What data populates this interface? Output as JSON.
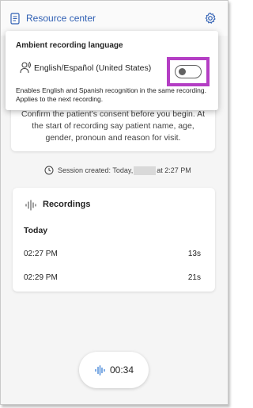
{
  "header": {
    "title": "Resource center",
    "doc_icon": "document-icon",
    "settings_icon": "gear-icon"
  },
  "popup": {
    "heading": "Ambient recording language",
    "language_icon": "person-voice-icon",
    "language_label": "English/Español (United States)",
    "toggle_state": "off",
    "description": "Enables English and Spanish recognition in the same recording. Applies to the next recording."
  },
  "consent": {
    "text": "Confirm the patient’s consent before you begin. At the start of recording say patient name, age, gender, pronoun and reason for visit."
  },
  "session": {
    "clock_icon": "clock-icon",
    "prefix": "Session created: Today,",
    "suffix": "at 2:27 PM"
  },
  "recordings": {
    "heading": "Recordings",
    "wave_icon": "sound-wave-icon",
    "group_label": "Today",
    "items": [
      {
        "time": "02:27 PM",
        "duration": "13s"
      },
      {
        "time": "02:29 PM",
        "duration": "21s"
      }
    ]
  },
  "recorder": {
    "elapsed": "00:34",
    "wave_icon": "sound-wave-icon"
  },
  "colors": {
    "accent": "#2f5fb3",
    "highlight": "#b43ec4",
    "wave": "#3a7fd5"
  }
}
